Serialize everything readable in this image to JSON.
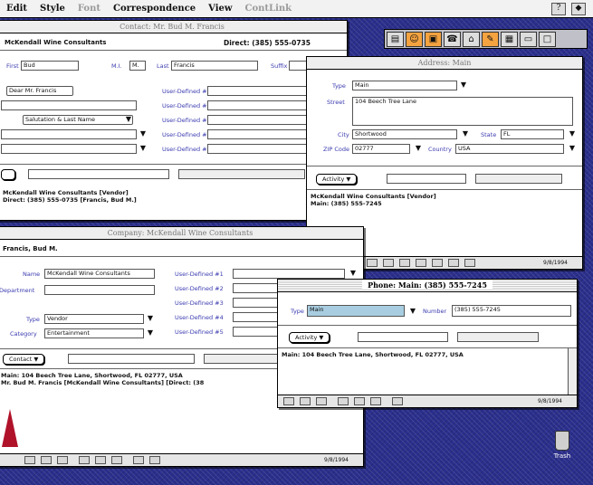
{
  "menubar": {
    "items": [
      {
        "label": "Edit",
        "dim": false
      },
      {
        "label": "Style",
        "dim": false
      },
      {
        "label": "Font",
        "dim": true
      },
      {
        "label": "Correspondence",
        "dim": false
      },
      {
        "label": "View",
        "dim": false
      },
      {
        "label": "ContLink",
        "dim": true
      }
    ],
    "right_icons": [
      "help-icon",
      "app-icon"
    ]
  },
  "contact_window": {
    "title": "Contact: Mr. Bud M. Francis",
    "company_line": "McKendall Wine Consultants",
    "direct_phone": "Direct: (385) 555-0735",
    "first_label": "First",
    "first_value": "Bud",
    "mi_label": "M.I.",
    "mi_value": "M.",
    "last_label": "Last",
    "last_value": "Francis",
    "suffix_label": "Suffix",
    "salutation_btn": "Dear Mr. Francis",
    "salutation_popup": "Salutation & Last Name",
    "user_defined": [
      "User-Defined #1",
      "User-Defined #2",
      "User-Defined #3",
      "User-Defined #4",
      "User-Defined #5"
    ],
    "memo_line1": "McKendall Wine Consultants [Vendor]",
    "memo_line2": "Direct: (385) 555-0735 [Francis, Bud M.]"
  },
  "address_window": {
    "title": "Address: Main",
    "type_label": "Type",
    "type_value": "Main",
    "street_label": "Street",
    "street_value": "104 Beech Tree Lane",
    "city_label": "City",
    "city_value": "Shortwood",
    "state_label": "State",
    "state_value": "FL",
    "zip_label": "ZIP Code",
    "zip_value": "02777",
    "country_label": "Country",
    "country_value": "USA",
    "activity_btn": "Activity",
    "memo_line1": "McKendall Wine Consultants [Vendor]",
    "memo_line2": "Main: (385) 555-7245",
    "date": "9/8/1994"
  },
  "company_window": {
    "title": "Company: McKendall Wine Consultants",
    "contact_line": "Francis, Bud M.",
    "name_label": "Name",
    "name_value": "McKendall Wine Consultants",
    "department_label": "Department",
    "type_label": "Type",
    "type_value": "Vendor",
    "category_label": "Category",
    "category_value": "Entertainment",
    "user_defined": [
      "User-Defined #1",
      "User-Defined #2",
      "User-Defined #3",
      "User-Defined #4",
      "User-Defined #5"
    ],
    "contact_btn": "Contact",
    "memo_line1": "Main: 104 Beech Tree Lane, Shortwood, FL 02777, USA",
    "memo_line2": "Mr. Bud M. Francis [McKendall Wine Consultants] [Direct: (38",
    "date": "9/8/1994"
  },
  "phone_window": {
    "title": "Phone: Main: (385) 555-7245",
    "type_label": "Type",
    "type_value": "Main",
    "number_label": "Number",
    "number_value": "(385) 555-7245",
    "activity_btn": "Activity",
    "memo_line1": "Main: 104 Beech Tree Lane, Shortwood, FL 02777, USA",
    "date": "9/8/1994"
  },
  "toolbar": {
    "buttons": [
      "rolodex-icon",
      "contact-icon",
      "company-icon",
      "phone-icon",
      "address-icon",
      "note-icon",
      "layout-icon",
      "print-icon",
      "window-icon"
    ]
  },
  "desktop": {
    "trash_label": "Trash"
  }
}
